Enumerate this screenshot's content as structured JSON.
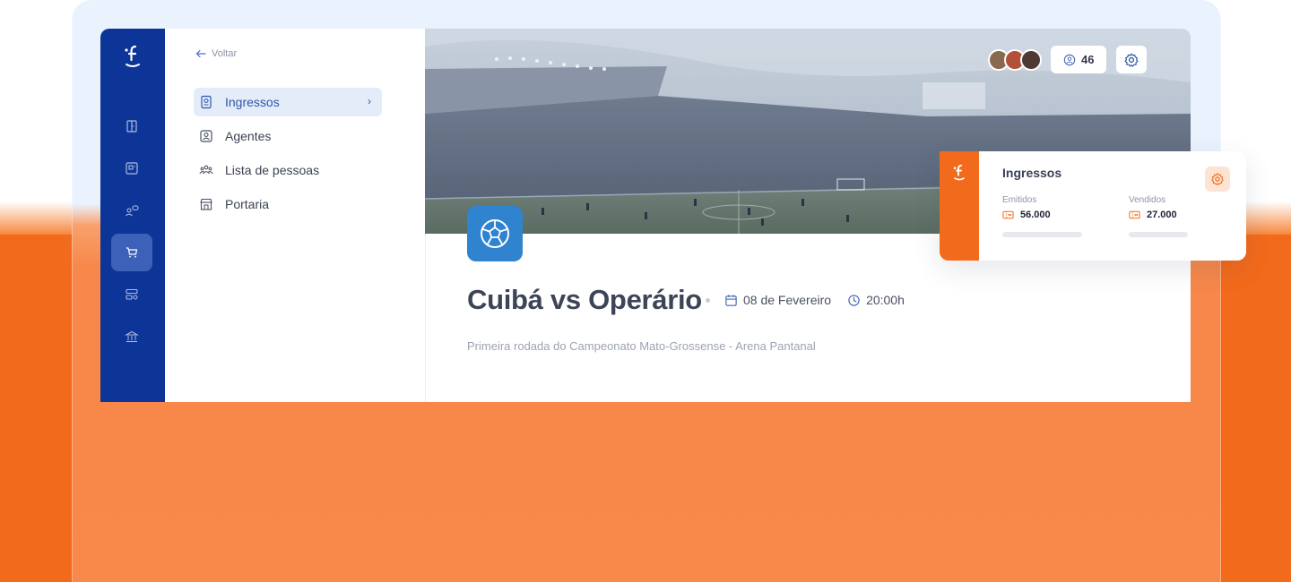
{
  "nav": {
    "back_label": "Voltar",
    "items": [
      {
        "label": "Ingressos",
        "icon": "ticket-icon",
        "active": true
      },
      {
        "label": "Agentes",
        "icon": "user-badge-icon",
        "active": false
      },
      {
        "label": "Lista de pessoas",
        "icon": "people-icon",
        "active": false
      },
      {
        "label": "Portaria",
        "icon": "storefront-icon",
        "active": false
      }
    ]
  },
  "rail": {
    "logo": "f",
    "items": [
      "door-icon",
      "id-card-icon",
      "people-chat-icon",
      "cart-icon",
      "settings-list-icon",
      "bank-icon"
    ],
    "active_index": 3
  },
  "header": {
    "attendee_count": "46"
  },
  "event": {
    "title": "Cuibá vs Operário",
    "date": "08 de Fevereiro",
    "time": "20:00h",
    "description": "Primeira rodada do Campeonato Mato-Grossense - Arena Pantanal",
    "icon": "soccer-ball-icon"
  },
  "ticket_card": {
    "title": "Ingressos",
    "issued_label": "Emitidos",
    "issued_value": "56.000",
    "sold_label": "Vendidos",
    "sold_value": "27.000"
  },
  "colors": {
    "brand_orange": "#f26b1c",
    "rail_blue": "#0d3597",
    "accent_blue": "#2f83cf"
  }
}
